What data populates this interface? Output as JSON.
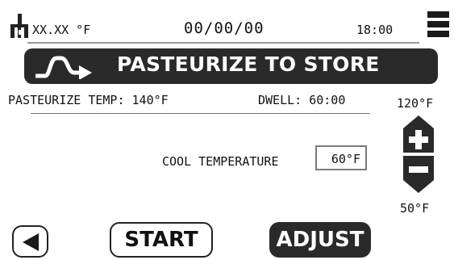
{
  "status_bar": {
    "temperature": "XX.XX °F",
    "date": "00/00/00",
    "time": "18:00",
    "icons": [
      "thermometer-icon",
      "menu-icon"
    ]
  },
  "banner": {
    "title": "PASTEURIZE TO STORE",
    "icon": "pasteurize-curve-icon"
  },
  "info": {
    "pasteurize_temp": "PASTEURIZE TEMP: 140°F",
    "dwell": "DWELL: 60:00"
  },
  "range": {
    "max": "120°F",
    "min": "50°F"
  },
  "cool": {
    "label": "COOL TEMPERATURE",
    "value": "60°F"
  },
  "buttons": {
    "back_icon": "back-arrow-icon",
    "start": "START",
    "adjust": "ADJUST",
    "increase_icon": "plus-arrow-up-icon",
    "decrease_icon": "minus-arrow-down-icon"
  },
  "colors": {
    "dark": "#2a2a2a",
    "rule": "#999999"
  }
}
